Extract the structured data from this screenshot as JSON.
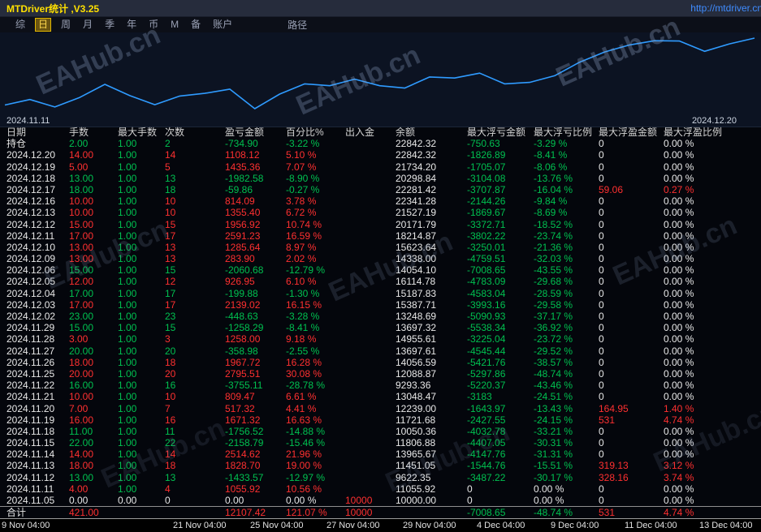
{
  "window": {
    "title": "MTDriver统计 ,V3.25",
    "url": "http://mtdriver.cn"
  },
  "toolbar": {
    "items": [
      "综",
      "日",
      "周",
      "月",
      "季",
      "年",
      "币",
      "M",
      "备",
      "账户"
    ],
    "selected_index": 1,
    "path_label": "路径"
  },
  "chart": {
    "range_start": "2024.11.11",
    "range_end": "2024.12.20",
    "line_color": "#2F9BFF",
    "watermark_text": "EAHub.cn"
  },
  "chart_data": {
    "type": "line",
    "title": "",
    "x": [
      "2024.11.05",
      "2024.11.11",
      "2024.11.12",
      "2024.11.13",
      "2024.11.14",
      "2024.11.15",
      "2024.11.18",
      "2024.11.19",
      "2024.11.20",
      "2024.11.21",
      "2024.11.22",
      "2024.11.25",
      "2024.11.26",
      "2024.11.27",
      "2024.11.28",
      "2024.11.29",
      "2024.12.02",
      "2024.12.03",
      "2024.12.04",
      "2024.12.05",
      "2024.12.06",
      "2024.12.09",
      "2024.12.10",
      "2024.12.11",
      "2024.12.12",
      "2024.12.13",
      "2024.12.16",
      "2024.12.17",
      "2024.12.18",
      "2024.12.19",
      "2024.12.20"
    ],
    "series": [
      {
        "name": "余额",
        "values": [
          10000.0,
          11055.92,
          9622.35,
          11451.05,
          13965.67,
          11806.88,
          10050.36,
          11721.68,
          12239.0,
          13048.47,
          9293.36,
          12088.87,
          14056.59,
          13697.61,
          14955.61,
          13697.32,
          13248.69,
          15387.71,
          15187.83,
          16114.78,
          14054.1,
          14338.0,
          15623.64,
          18214.87,
          20171.79,
          21527.19,
          22341.28,
          22281.42,
          20298.84,
          21734.2,
          22842.32
        ]
      }
    ],
    "ylim": [
      9000,
      23500
    ],
    "grid": false,
    "legend": false,
    "x_range_labels": [
      "2024.11.11",
      "2024.12.20"
    ],
    "bottom_axis_labels": [
      "9 Nov 04:00",
      "21 Nov 04:00",
      "25 Nov 04:00",
      "27 Nov 04:00",
      "29 Nov 04:00",
      "4 Dec 04:00",
      "9 Dec 04:00",
      "11 Dec 04:00",
      "13 Dec 04:00"
    ]
  },
  "palette": {
    "r": "#FF3030",
    "g": "#00C050",
    "w": "#E8E8E8"
  },
  "table": {
    "headers": [
      "日期",
      "手数",
      "最大手数",
      "次数",
      "盈亏金额",
      "百分比%",
      "出入金",
      "余额",
      "最大浮亏金额",
      "最大浮亏比例",
      "最大浮盈金额",
      "最大浮盈比例"
    ],
    "rows": [
      {
        "c": [
          "持仓",
          "2.00",
          "1.00",
          "2",
          "-734.90",
          "-3.22 %",
          "",
          "22842.32",
          "-750.63",
          "-3.29 %",
          "0",
          "0.00 %"
        ],
        "k": "wgggggwwggww"
      },
      {
        "c": [
          "2024.12.20",
          "14.00",
          "1.00",
          "14",
          "1108.12",
          "5.10 %",
          "",
          "22842.32",
          "-1826.89",
          "-8.41 %",
          "0",
          "0.00 %"
        ],
        "k": "wrgrrrwwggww"
      },
      {
        "c": [
          "2024.12.19",
          "5.00",
          "1.00",
          "5",
          "1435.36",
          "7.07 %",
          "",
          "21734.20",
          "-1705.07",
          "-8.06 %",
          "0",
          "0.00 %"
        ],
        "k": "wrgrrrwwggww"
      },
      {
        "c": [
          "2024.12.18",
          "13.00",
          "1.00",
          "13",
          "-1982.58",
          "-8.90 %",
          "",
          "20298.84",
          "-3104.08",
          "-13.76 %",
          "0",
          "0.00 %"
        ],
        "k": "wgggggwwggww"
      },
      {
        "c": [
          "2024.12.17",
          "18.00",
          "1.00",
          "18",
          "-59.86",
          "-0.27 %",
          "",
          "22281.42",
          "-3707.87",
          "-16.04 %",
          "59.06",
          "0.27 %"
        ],
        "k": "wgggggwwggrr"
      },
      {
        "c": [
          "2024.12.16",
          "10.00",
          "1.00",
          "10",
          "814.09",
          "3.78 %",
          "",
          "22341.28",
          "-2144.26",
          "-9.84 %",
          "0",
          "0.00 %"
        ],
        "k": "wrgrrrwwggww"
      },
      {
        "c": [
          "2024.12.13",
          "10.00",
          "1.00",
          "10",
          "1355.40",
          "6.72 %",
          "",
          "21527.19",
          "-1869.67",
          "-8.69 %",
          "0",
          "0.00 %"
        ],
        "k": "wrgrrrwwggww"
      },
      {
        "c": [
          "2024.12.12",
          "15.00",
          "1.00",
          "15",
          "1956.92",
          "10.74 %",
          "",
          "20171.79",
          "-3372.71",
          "-18.52 %",
          "0",
          "0.00 %"
        ],
        "k": "wrgrrrwwggww"
      },
      {
        "c": [
          "2024.12.11",
          "17.00",
          "1.00",
          "17",
          "2591.23",
          "16.59 %",
          "",
          "18214.87",
          "-3802.22",
          "-23.74 %",
          "0",
          "0.00 %"
        ],
        "k": "wrgrrrwwggww"
      },
      {
        "c": [
          "2024.12.10",
          "13.00",
          "1.00",
          "13",
          "1285.64",
          "8.97 %",
          "",
          "15623.64",
          "-3250.01",
          "-21.36 %",
          "0",
          "0.00 %"
        ],
        "k": "wrgrrrwwggww"
      },
      {
        "c": [
          "2024.12.09",
          "13.00",
          "1.00",
          "13",
          "283.90",
          "2.02 %",
          "",
          "14338.00",
          "-4759.51",
          "-32.03 %",
          "0",
          "0.00 %"
        ],
        "k": "wrgrrrwwggww"
      },
      {
        "c": [
          "2024.12.06",
          "15.00",
          "1.00",
          "15",
          "-2060.68",
          "-12.79 %",
          "",
          "14054.10",
          "-7008.65",
          "-43.55 %",
          "0",
          "0.00 %"
        ],
        "k": "wgggggwwggww"
      },
      {
        "c": [
          "2024.12.05",
          "12.00",
          "1.00",
          "12",
          "926.95",
          "6.10 %",
          "",
          "16114.78",
          "-4783.09",
          "-29.68 %",
          "0",
          "0.00 %"
        ],
        "k": "wrgrrrwwggww"
      },
      {
        "c": [
          "2024.12.04",
          "17.00",
          "1.00",
          "17",
          "-199.88",
          "-1.30 %",
          "",
          "15187.83",
          "-4583.04",
          "-28.59 %",
          "0",
          "0.00 %"
        ],
        "k": "wgggggwwggww"
      },
      {
        "c": [
          "2024.12.03",
          "17.00",
          "1.00",
          "17",
          "2139.02",
          "16.15 %",
          "",
          "15387.71",
          "-3993.16",
          "-29.58 %",
          "0",
          "0.00 %"
        ],
        "k": "wrgrrrwwggww"
      },
      {
        "c": [
          "2024.12.02",
          "23.00",
          "1.00",
          "23",
          "-448.63",
          "-3.28 %",
          "",
          "13248.69",
          "-5090.93",
          "-37.17 %",
          "0",
          "0.00 %"
        ],
        "k": "wgggggwwggww"
      },
      {
        "c": [
          "2024.11.29",
          "15.00",
          "1.00",
          "15",
          "-1258.29",
          "-8.41 %",
          "",
          "13697.32",
          "-5538.34",
          "-36.92 %",
          "0",
          "0.00 %"
        ],
        "k": "wgggggwwggww"
      },
      {
        "c": [
          "2024.11.28",
          "3.00",
          "1.00",
          "3",
          "1258.00",
          "9.18 %",
          "",
          "14955.61",
          "-3225.04",
          "-23.72 %",
          "0",
          "0.00 %"
        ],
        "k": "wrgrrrwwggww"
      },
      {
        "c": [
          "2024.11.27",
          "20.00",
          "1.00",
          "20",
          "-358.98",
          "-2.55 %",
          "",
          "13697.61",
          "-4545.44",
          "-29.52 %",
          "0",
          "0.00 %"
        ],
        "k": "wgggggwwggww"
      },
      {
        "c": [
          "2024.11.26",
          "18.00",
          "1.00",
          "18",
          "1967.72",
          "16.28 %",
          "",
          "14056.59",
          "-5421.76",
          "-38.57 %",
          "0",
          "0.00 %"
        ],
        "k": "wrgrrrwwggww"
      },
      {
        "c": [
          "2024.11.25",
          "20.00",
          "1.00",
          "20",
          "2795.51",
          "30.08 %",
          "",
          "12088.87",
          "-5297.86",
          "-48.74 %",
          "0",
          "0.00 %"
        ],
        "k": "wrgrrrwwggww"
      },
      {
        "c": [
          "2024.11.22",
          "16.00",
          "1.00",
          "16",
          "-3755.11",
          "-28.78 %",
          "",
          "9293.36",
          "-5220.37",
          "-43.46 %",
          "0",
          "0.00 %"
        ],
        "k": "wgggggwwggww"
      },
      {
        "c": [
          "2024.11.21",
          "10.00",
          "1.00",
          "10",
          "809.47",
          "6.61 %",
          "",
          "13048.47",
          "-3183",
          "-24.51 %",
          "0",
          "0.00 %"
        ],
        "k": "wrgrrrwwggww"
      },
      {
        "c": [
          "2024.11.20",
          "7.00",
          "1.00",
          "7",
          "517.32",
          "4.41 %",
          "",
          "12239.00",
          "-1643.97",
          "-13.43 %",
          "164.95",
          "1.40 %"
        ],
        "k": "wrgrrrwwggrr"
      },
      {
        "c": [
          "2024.11.19",
          "16.00",
          "1.00",
          "16",
          "1671.32",
          "16.63 %",
          "",
          "11721.68",
          "-2427.55",
          "-24.15 %",
          "531",
          "4.74 %"
        ],
        "k": "wrgrrrwwggrr"
      },
      {
        "c": [
          "2024.11.18",
          "11.00",
          "1.00",
          "11",
          "-1756.52",
          "-14.88 %",
          "",
          "10050.36",
          "-4032.78",
          "-33.21 %",
          "0",
          "0.00 %"
        ],
        "k": "wgggggwwggww"
      },
      {
        "c": [
          "2024.11.15",
          "22.00",
          "1.00",
          "22",
          "-2158.79",
          "-15.46 %",
          "",
          "11806.88",
          "-4407.05",
          "-30.31 %",
          "0",
          "0.00 %"
        ],
        "k": "wgggggwwggww"
      },
      {
        "c": [
          "2024.11.14",
          "14.00",
          "1.00",
          "14",
          "2514.62",
          "21.96 %",
          "",
          "13965.67",
          "-4147.76",
          "-31.31 %",
          "0",
          "0.00 %"
        ],
        "k": "wrgrrrwwggww"
      },
      {
        "c": [
          "2024.11.13",
          "18.00",
          "1.00",
          "18",
          "1828.70",
          "19.00 %",
          "",
          "11451.05",
          "-1544.76",
          "-15.51 %",
          "319.13",
          "3.12 %"
        ],
        "k": "wrgrrrwwggrr"
      },
      {
        "c": [
          "2024.11.12",
          "13.00",
          "1.00",
          "13",
          "-1433.57",
          "-12.97 %",
          "",
          "9622.35",
          "-3487.22",
          "-30.17 %",
          "328.16",
          "3.74 %"
        ],
        "k": "wgggggwwggrr"
      },
      {
        "c": [
          "2024.11.11",
          "4.00",
          "1.00",
          "4",
          "1055.92",
          "10.56 %",
          "",
          "11055.92",
          "0",
          "0.00 %",
          "0",
          "0.00 %"
        ],
        "k": "wrgrrrwwwwww"
      },
      {
        "c": [
          "2024.11.05",
          "0.00",
          "0.00",
          "0",
          "0.00",
          "0.00 %",
          "10000",
          "10000.00",
          "0",
          "0.00 %",
          "0",
          "0.00 %"
        ],
        "k": "wwwwwwrwwwww"
      },
      {
        "c": [
          "合计",
          "421.00",
          "",
          "",
          "12107.42",
          "121.07 %",
          "10000",
          "",
          "-7008.65",
          "-48.74 %",
          "531",
          "4.74 %"
        ],
        "k": "wrwwrrrwggrr",
        "total": true
      }
    ]
  }
}
